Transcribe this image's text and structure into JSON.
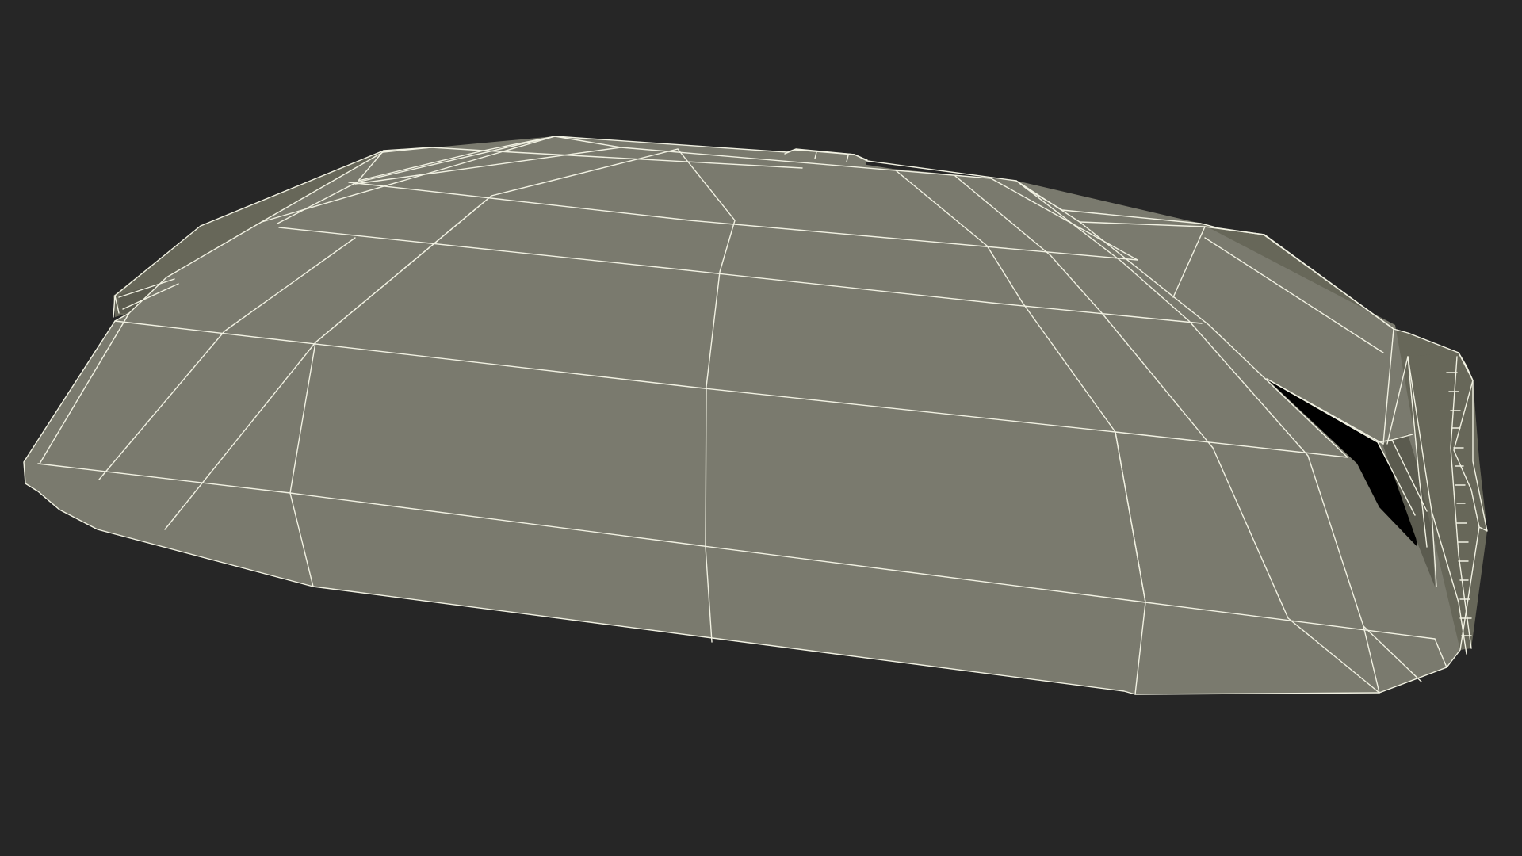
{
  "scene": {
    "background_color": "#262626",
    "mesh_fill_color": "#7a7a6e",
    "mesh_shadow_color": "#676759",
    "mesh_dark_color": "#5b5b4f",
    "wire_color": "#f1f1e2",
    "opening_color": "#000000",
    "object": "wireframe-mesh-model"
  }
}
